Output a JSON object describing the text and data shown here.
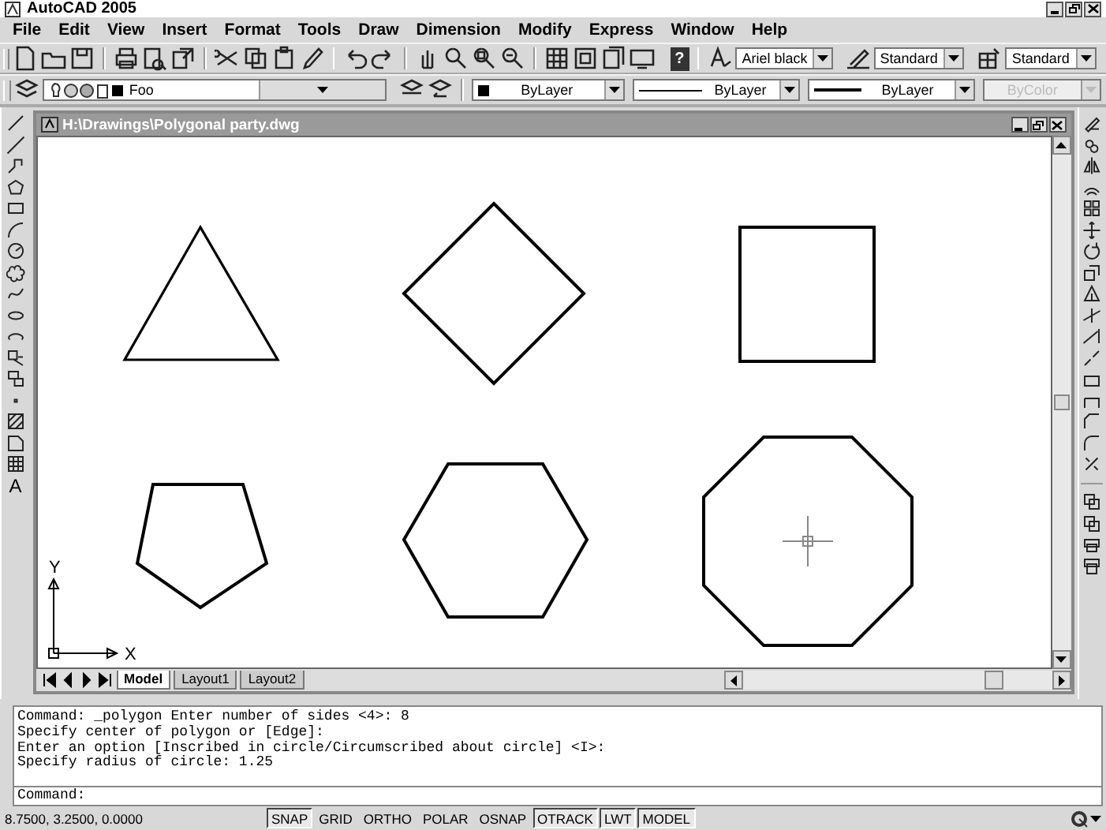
{
  "window": {
    "title": "AutoCAD 2005"
  },
  "menu": [
    "File",
    "Edit",
    "View",
    "Insert",
    "Format",
    "Tools",
    "Draw",
    "Dimension",
    "Modify",
    "Express",
    "Window",
    "Help"
  ],
  "standard_toolbar": {
    "help_label": "?"
  },
  "style_toolbar": [
    {
      "kind": "text",
      "value": "Ariel black"
    },
    {
      "kind": "dimension",
      "value": "Standard"
    },
    {
      "kind": "table",
      "value": "Standard"
    }
  ],
  "layer_toolbar": {
    "layer": "Foo"
  },
  "properties_toolbar": [
    {
      "kind": "color",
      "value": "ByLayer",
      "disabled": false
    },
    {
      "kind": "linetype",
      "value": "ByLayer",
      "disabled": false
    },
    {
      "kind": "lineweight",
      "value": "ByLayer",
      "disabled": false
    },
    {
      "kind": "plotstyle",
      "value": "ByColor",
      "disabled": true
    }
  ],
  "draw_toolbar": {
    "text_label": "A"
  },
  "drawing_window": {
    "title": "H:\\Drawings\\Polygonal party.dwg",
    "ucs": {
      "x_label": "X",
      "y_label": "Y"
    },
    "tabs": [
      {
        "label": "Model",
        "selected": true
      },
      {
        "label": "Layout1",
        "selected": false
      },
      {
        "label": "Layout2",
        "selected": false
      }
    ]
  },
  "command_history": [
    "Command: _polygon Enter number of sides <4>: 8",
    "Specify center of polygon or [Edge]:",
    "Enter an option [Inscribed in circle/Circumscribed about circle] <I>:",
    "Specify radius of circle: 1.25"
  ],
  "command_prompt": "Command:",
  "status_bar": {
    "coordinates": "8.7500, 3.2500, 0.0000",
    "toggles": [
      {
        "label": "SNAP",
        "on": true
      },
      {
        "label": "GRID",
        "on": false
      },
      {
        "label": "ORTHO",
        "on": false
      },
      {
        "label": "POLAR",
        "on": false
      },
      {
        "label": "OSNAP",
        "on": false
      },
      {
        "label": "OTRACK",
        "on": true
      },
      {
        "label": "LWT",
        "on": true
      },
      {
        "label": "MODEL",
        "on": true
      }
    ]
  }
}
